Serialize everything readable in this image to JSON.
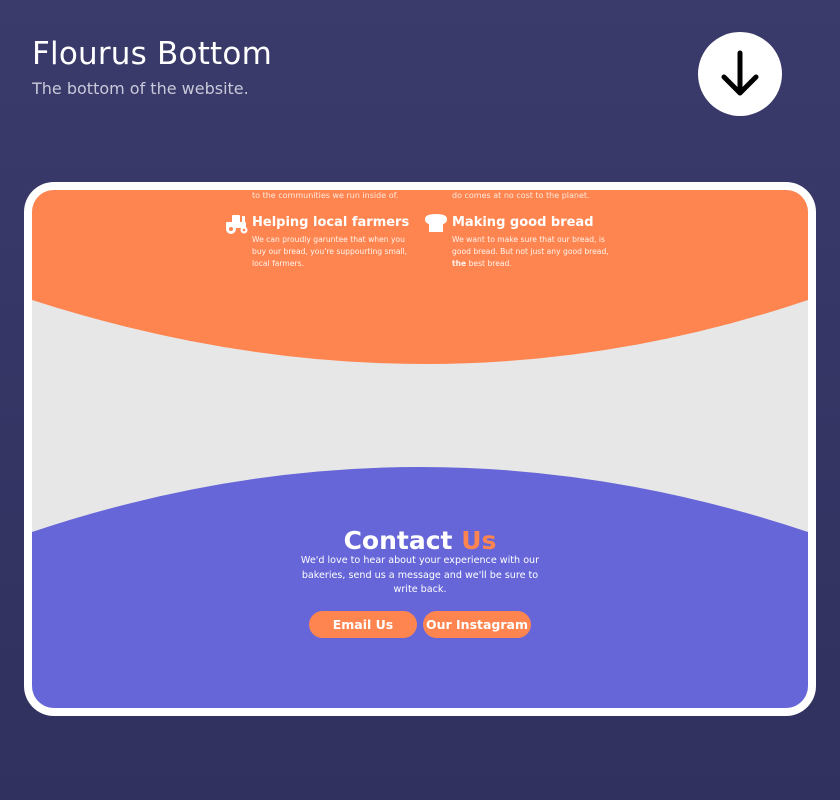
{
  "header": {
    "title": "Flourus Bottom",
    "subtitle": "The bottom of the website."
  },
  "download_icon": "arrow-down-icon",
  "colors": {
    "page_bg": "#37376a",
    "orange": "#ff8550",
    "grey": "#e7e7e7",
    "purple": "#6666d9",
    "white": "#ffffff"
  },
  "features": {
    "cut_left": "to the communities we run inside of.",
    "cut_right": "do comes at no cost to the planet.",
    "farmers": {
      "icon": "tractor-icon",
      "title": "Helping local farmers",
      "desc": "We can proudly garuntee that when you buy our bread, you're suppourting small, local farmers."
    },
    "bread": {
      "icon": "bread-icon",
      "title": "Making good bread",
      "desc_pre": "We want to make sure that our bread, is good bread. But not just any good bread,",
      "desc_bold": "the",
      "desc_post": "best bread."
    }
  },
  "contact": {
    "title_main": "Contact",
    "title_accent": "Us",
    "text": "We'd love to hear about your experience with our bakeries, send us a message and we'll be sure to write back.",
    "email_label": "Email Us",
    "instagram_label": "Our Instagram"
  }
}
